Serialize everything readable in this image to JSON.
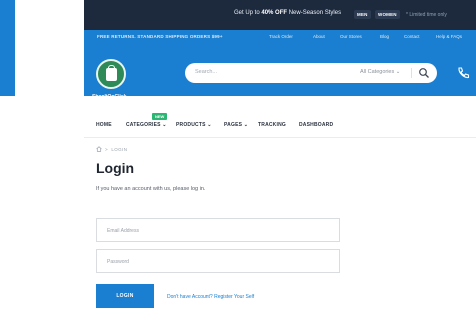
{
  "top_bar": {
    "promo_prefix": "Get Up to ",
    "promo_highlight": "40% OFF",
    "promo_suffix": " New-Season Styles",
    "men": "MEN",
    "women": "WOMEN",
    "limited": "* Limited time only"
  },
  "nav_bar": {
    "free_returns": "FREE RETURNS. STANDARD SHIPPING ORDERS $99+",
    "links": [
      "Track Order",
      "About",
      "Our Stores",
      "Blog",
      "Contact",
      "Help & FAQs"
    ]
  },
  "header": {
    "logo_text": "ShopItOnClick",
    "search_placeholder": "Search...",
    "search_category": "All Categories"
  },
  "menu": {
    "items": [
      "HOME",
      "CATEGORIES",
      "PRODUCTS",
      "PAGES",
      "TRACKING",
      "DASHBOARD"
    ],
    "new_badge": "NEW"
  },
  "breadcrumb": {
    "separator": ">",
    "current": "LOGIN"
  },
  "page": {
    "title": "Login",
    "intro": "If you have an account with us, please log in."
  },
  "form": {
    "email_placeholder": "Email Address",
    "password_placeholder": "Password",
    "login_label": "LOGIN",
    "register_text": "Don't have Account? Register Your Self"
  },
  "colors": {
    "brand_blue": "#1a7fd0",
    "dark_navy": "#1d2a3e",
    "logo_green": "#2e8b57",
    "badge_green": "#2bb673"
  },
  "icons": [
    "search-icon",
    "phone-icon",
    "home-icon",
    "shopping-bag-icon",
    "chevron-down-icon"
  ]
}
